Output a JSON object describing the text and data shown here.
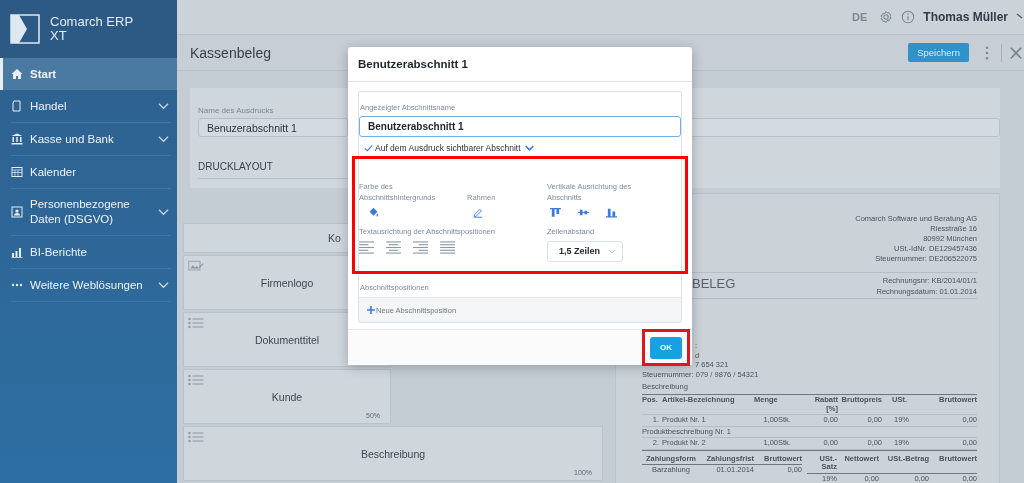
{
  "sidebar": {
    "logo_text": "Comarch ERP XT",
    "items": [
      {
        "label": "Start",
        "selected": true,
        "has_submenu": false
      },
      {
        "label": "Handel",
        "selected": false,
        "has_submenu": true
      },
      {
        "label": "Kasse und Bank",
        "selected": false,
        "has_submenu": true
      },
      {
        "label": "Kalender",
        "selected": false,
        "has_submenu": false
      },
      {
        "label": "Personenbezogene Daten (DSGVO)",
        "selected": false,
        "has_submenu": true
      },
      {
        "label": "BI-Berichte",
        "selected": false,
        "has_submenu": false
      },
      {
        "label": "Weitere Weblösungen",
        "selected": false,
        "has_submenu": true
      }
    ]
  },
  "header": {
    "language": "DE",
    "user": "Thomas Müller"
  },
  "page": {
    "title": "Kassenbeleg",
    "save_button": "Speichern"
  },
  "print_name": {
    "label": "Name des Ausdrucks",
    "value": "Benuzerabschnitt 1"
  },
  "section_heading": "DRUCKLAYOUT",
  "layout_blocks": [
    {
      "label": "Ko",
      "kind": "cut"
    },
    {
      "label": "Firmenlogo",
      "kind": "image"
    },
    {
      "label": "Dokumenttitel",
      "kind": "list"
    },
    {
      "label": "Kunde",
      "kind": "list",
      "share": "50%"
    },
    {
      "label": "Beschreibung",
      "kind": "list",
      "share": "100%"
    }
  ],
  "preview": {
    "company_lines": [
      "Comarch Software und Beratung AG",
      "Riesstraße 16",
      "80992 München",
      "USt.-IdNr. DE129457436",
      "Steuernummer: DE206522075"
    ],
    "title": "BELEG",
    "invoice_no": "Rechnungsnr: KB/2014/01/1",
    "invoice_date": "Rechnungsdatum: 01.01.2014",
    "customer_lines": [
      {
        "text": ":",
        "cut": true
      },
      {
        "text": "d",
        "cut": true
      },
      {
        "text": "7 654 321",
        "cut": true
      },
      {
        "text": "Steuernummer: 079 / 9876 / 54321",
        "cut": false
      }
    ],
    "description_label": "Beschreibung",
    "items_table": {
      "columns": [
        "Pos.",
        "Artikel-Bezeichnung",
        "Menge",
        "",
        "Rabatt [%]",
        "Bruttopreis",
        "USt.",
        "Bruttowert"
      ],
      "rows": [
        {
          "kind": "item",
          "cells": [
            "1.",
            "Produkt Nr. 1",
            "1,00",
            "Stk.",
            "0,00",
            "0,00",
            "19%",
            "0,00"
          ]
        },
        {
          "kind": "note",
          "cells": [
            "Produktbeschreibung Nr. 1"
          ]
        },
        {
          "kind": "item",
          "cells": [
            "2.",
            "Produkt Nr. 2",
            "1,00",
            "Stk.",
            "0,00",
            "0,00",
            "19%",
            "0,00"
          ]
        }
      ]
    },
    "payment_table": {
      "columns": [
        "Zahlungsform",
        "Zahlungsfrist",
        "Bruttowert"
      ],
      "rows": [
        [
          "Barzahlung",
          "01.01.2014",
          "0,00"
        ]
      ]
    },
    "vat_table": {
      "columns": [
        "USt.-Satz",
        "Nettowert",
        "USt.-Betrag",
        "Bruttowert"
      ],
      "rows": [
        [
          "19%",
          "0,00",
          "0,00",
          "0,00"
        ]
      ]
    }
  },
  "dialog": {
    "title": "Benutzerabschnitt 1",
    "name_label": "Angezeigter Abschnittsname",
    "name_value": "Benutzerabschnitt 1",
    "visible_option": {
      "label": "Auf dem Ausdruck sichtbarer Abschnitt",
      "checked": true
    },
    "options_highlighted": true,
    "background_label": "Farbe des Abschnittshintergrunds",
    "border_label": "Rahmen",
    "vertical_label": "Vertikale Ausrichtung des Abschnitts",
    "text_align_label": "Textausrichtung der Abschnittspositionen",
    "line_spacing_label": "Zeilenabstand",
    "line_spacing_value": "1,5 Zeilen",
    "positions_label": "Abschnittspositionen",
    "add_position": "Neue Abschnittsposition",
    "ok_button": "OK",
    "ok_highlighted": true
  }
}
